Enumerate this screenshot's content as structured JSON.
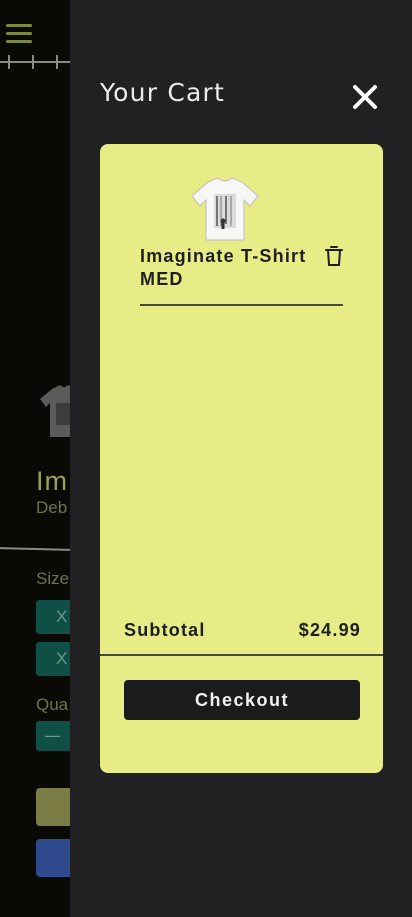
{
  "background_page": {
    "product_title_partial": "Im",
    "artist_partial": "Deb",
    "size_label_partial": "Size",
    "size_options_partial": [
      "X",
      "X"
    ],
    "quantity_label_partial": "Qua",
    "quantity_decrement": "—"
  },
  "cart": {
    "title": "Your Cart",
    "close_icon": "close-icon",
    "items": [
      {
        "name": "Imaginate T-Shirt",
        "size": "MED",
        "image_icon": "tshirt-image",
        "remove_icon": "trash-icon"
      }
    ],
    "subtotal_label": "Subtotal",
    "subtotal_value": "$24.99",
    "checkout_label": "Checkout"
  },
  "colors": {
    "drawer_bg": "#212123",
    "panel_bg": "#e7ec87",
    "checkout_bg": "#1b1b1d",
    "size_button_bg": "#0f4f45"
  }
}
